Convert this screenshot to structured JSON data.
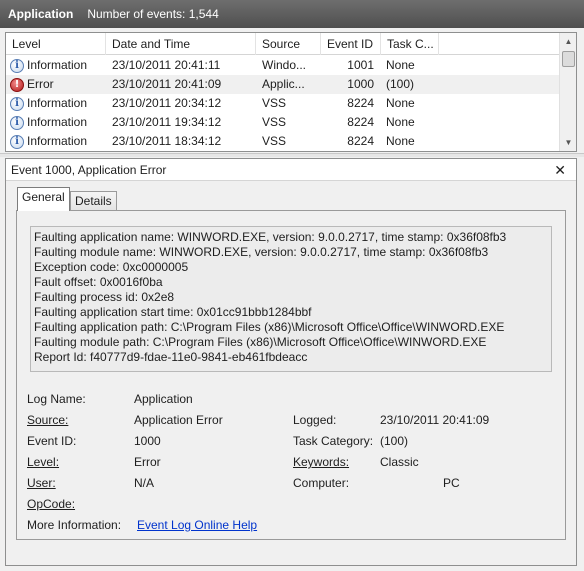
{
  "titlebar": {
    "log_name": "Application",
    "events_label": "Number of events: 1,544"
  },
  "list": {
    "columns": [
      "Level",
      "Date and Time",
      "Source",
      "Event ID",
      "Task C..."
    ],
    "rows": [
      {
        "icon": "info-icon",
        "level": "Information",
        "date": "23/10/2011 20:41:11",
        "source": "Windo...",
        "id": "1001",
        "task": "None"
      },
      {
        "icon": "error-icon",
        "level": "Error",
        "date": "23/10/2011 20:41:09",
        "source": "Applic...",
        "id": "1000",
        "task": "(100)"
      },
      {
        "icon": "info-icon",
        "level": "Information",
        "date": "23/10/2011 20:34:12",
        "source": "VSS",
        "id": "8224",
        "task": "None"
      },
      {
        "icon": "info-icon",
        "level": "Information",
        "date": "23/10/2011 19:34:12",
        "source": "VSS",
        "id": "8224",
        "task": "None"
      },
      {
        "icon": "info-icon",
        "level": "Information",
        "date": "23/10/2011 18:34:12",
        "source": "VSS",
        "id": "8224",
        "task": "None"
      }
    ]
  },
  "details": {
    "title": "Event 1000, Application Error",
    "close_glyph": "✕",
    "tabs": [
      "General",
      "Details"
    ],
    "message": [
      "Faulting application name: WINWORD.EXE, version: 9.0.0.2717, time stamp: 0x36f08fb3",
      "Faulting module name: WINWORD.EXE, version: 9.0.0.2717, time stamp: 0x36f08fb3",
      "Exception code: 0xc0000005",
      "Fault offset: 0x0016f0ba",
      "Faulting process id: 0x2e8",
      "Faulting application start time: 0x01cc91bbb1284bbf",
      "Faulting application path: C:\\Program Files (x86)\\Microsoft Office\\Office\\WINWORD.EXE",
      "Faulting module path: C:\\Program Files (x86)\\Microsoft Office\\Office\\WINWORD.EXE",
      "Report Id: f40777d9-fdae-11e0-9841-eb461fbdeacc"
    ],
    "props": {
      "log_name_label": "Log Name:",
      "log_name": "Application",
      "source_label": "Source:",
      "source": "Application Error",
      "logged_label": "Logged:",
      "logged": "23/10/2011 20:41:09",
      "event_id_label": "Event ID:",
      "event_id": "1000",
      "task_category_label": "Task Category:",
      "task_category": "(100)",
      "level_label": "Level:",
      "level": "Error",
      "keywords_label": "Keywords:",
      "keywords": "Classic",
      "user_label": "User:",
      "user": "N/A",
      "computer_label": "Computer:",
      "computer": "PC",
      "opcode_label": "OpCode:",
      "more_info_label": "More Information:",
      "more_info_link": "Event Log Online Help"
    }
  },
  "colors": {
    "titlebar": "#5a5a5a",
    "link": "#0033cc",
    "error": "#b11818",
    "info": "#2a5aa8"
  }
}
